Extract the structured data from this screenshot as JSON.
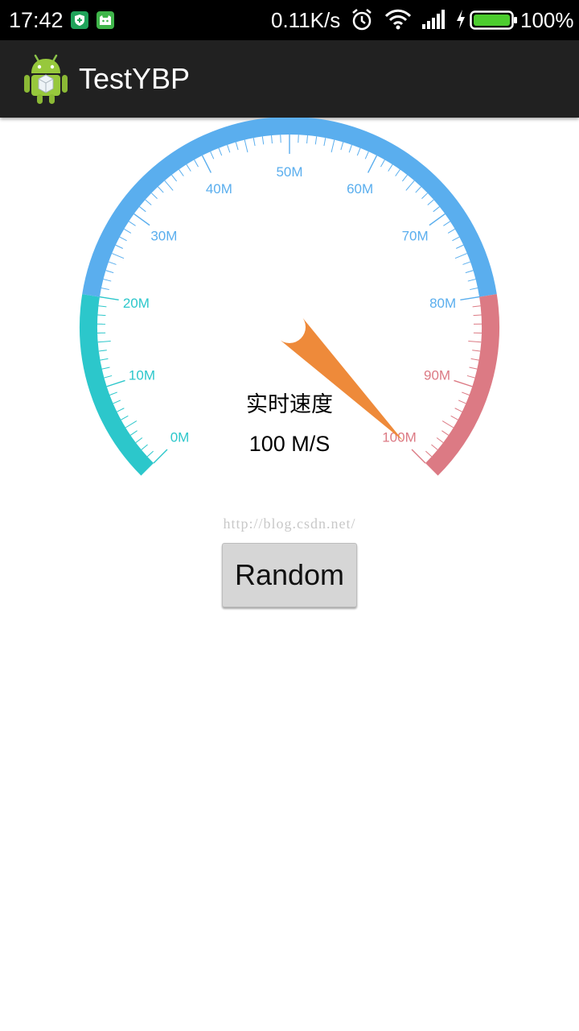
{
  "status_bar": {
    "time": "17:42",
    "net_speed": "0.11K/s",
    "battery": "100%",
    "icons": [
      "shield-icon",
      "cat-icon",
      "alarm-icon",
      "wifi-icon",
      "signal-icon",
      "charging-icon",
      "battery-icon"
    ]
  },
  "action_bar": {
    "title": "TestYBP",
    "icon": "android-app-icon"
  },
  "gauge": {
    "title": "实时速度",
    "value_label": "100 M/S",
    "value": 100,
    "min": 0,
    "max": 100,
    "unit_suffix": "M",
    "tick_labels": [
      "0M",
      "10M",
      "20M",
      "30M",
      "40M",
      "50M",
      "60M",
      "70M",
      "80M",
      "90M",
      "100M"
    ],
    "ranges": [
      {
        "from": 0,
        "to": 20,
        "color": "#2cc7cb"
      },
      {
        "from": 20,
        "to": 80,
        "color": "#5aaeee"
      },
      {
        "from": 80,
        "to": 100,
        "color": "#dc7a84"
      }
    ],
    "needle_color": "#ee8a3a"
  },
  "watermark": "http://blog.csdn.net/",
  "random_button": {
    "label": "Random"
  }
}
